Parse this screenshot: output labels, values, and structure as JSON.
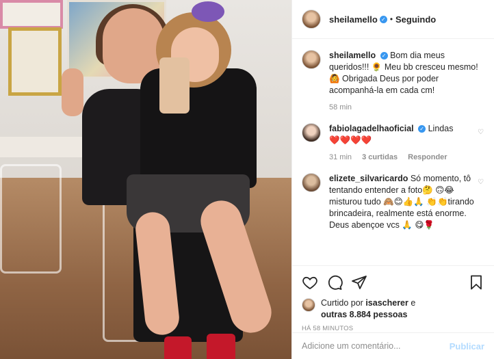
{
  "post": {
    "author": {
      "username": "sheilamello",
      "verified": true,
      "follow_status": "Seguindo"
    },
    "caption": {
      "username": "sheilamello",
      "text": "Bom dia meus queridos!!! 🌻 Meu bb cresceu mesmo!🙆 Obrigada Deus por poder acompanhá-la em cada cm!",
      "time": "58 min"
    },
    "comments": [
      {
        "username": "fabiolagadelhaoficial",
        "verified": true,
        "text": "Lindas",
        "emoji_line": "❤️❤️❤️❤️",
        "time": "31 min",
        "likes": "3 curtidas",
        "reply": "Responder"
      },
      {
        "username": "elizete_silvaricardo",
        "verified": false,
        "text": "Só momento, tô tentando entender a foto🤔 🙃😂 misturou tudo 🙈😊👍🙏 👏👏tirando brincadeira, realmente está enorme. Deus abençoe vcs 🙏 😋🌹"
      }
    ],
    "likes": {
      "prefix": "Curtido por",
      "user": "isascherer",
      "connector": "e",
      "others": "outras 8.884 pessoas"
    },
    "timestamp": "HÁ 58 MINUTOS",
    "comment_input": {
      "placeholder": "Adicione um comentário...",
      "publish_label": "Publicar"
    }
  },
  "icons": {
    "like": "heart-icon",
    "comment": "comment-icon",
    "share": "share-icon",
    "save": "bookmark-icon"
  },
  "colors": {
    "verified": "#3897f0",
    "publish_disabled": "#b3dbff",
    "muted": "#8e8e8e"
  }
}
